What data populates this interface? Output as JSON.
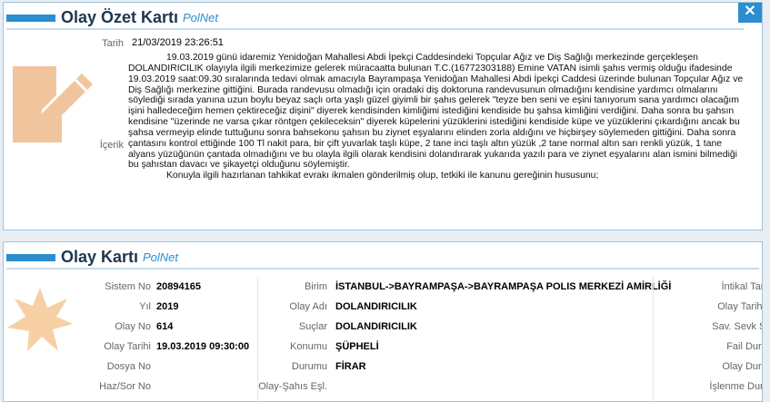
{
  "summary_card": {
    "title": "Olay Özet Kartı",
    "subtitle": "PolNet",
    "close": "✕",
    "date_label": "Tarih",
    "date_value": "21/03/2019 23:26:51",
    "content_label": "İçerik",
    "paragraph1": "19.03.2019 günü idaremiz Yenidoğan Mahallesi Abdi İpekçi Caddesindeki Topçular Ağız ve Diş Sağlığı merkezinde gerçekleşen DOLANDIRICILIK olayıyla ilgili merkezimize gelerek müracaatta bulunan T.C.(16772303188) Emine VATAN isimli şahıs vermiş olduğu ifadesinde 19.03.2019 saat:09.30 sıralarında tedavi olmak amacıyla Bayrampaşa Yenidoğan Mahallesi Abdi İpekçi Caddesi üzerinde bulunan Topçular Ağız ve Diş Sağlığı merkezine gittiğini. Burada randevusu olmadığı için oradaki diş doktoruna randevusunun olmadığını kendisine yardımcı olmalarını söylediği sırada yanına uzun boylu beyaz saçlı orta yaşlı güzel giyimli bir şahıs gelerek \"teyze ben seni ve eşini tanıyorum sana yardımcı olacağım işini halledeceğim hemen çektireceğiz dişini\" diyerek kendisinden kimliğimi istediğini kendiside bu şahsa kimliğini verdiğini. Daha sonra bu şahsın kendisine \"üzerinde ne varsa çıkar röntgen çekileceksin\" diyerek küpelerini yüzüklerini istediğini kendiside küpe ve yüzüklerini çıkardığını ancak bu şahsa vermeyip elinde tuttuğunu sonra bahsekonu şahsın bu ziynet eşyalarını elinden zorla aldığını ve hiçbirşey söylemeden gittiğini. Daha sonra çantasını kontrol ettiğinde 100 Tl nakit para, bir çift yuvarlak taşlı küpe, 2 tane inci taşlı altın yüzük ,2 tane normal altın sarı renkli yüzük, 1 tane alyans yüzüğünün çantada olmadığını ve bu olayla ilgili olarak kendisini dolandırarak yukarıda yazılı para ve ziynet eşyalarını alan ismini bilmediği bu şahıstan davacı ve şikayetçi olduğunu söylemiştir.",
    "paragraph2": "Konuyla ilgili hazırlanan tahkikat evrakı ikmalen gönderilmiş olup, tetkiki ile kanunu gereğinin hususunu;"
  },
  "event_card": {
    "title": "Olay Kartı",
    "subtitle": "PolNet",
    "col1": {
      "sistem_no_label": "Sistem No",
      "sistem_no": "20894165",
      "yil_label": "Yıl",
      "yil": "2019",
      "olay_no_label": "Olay No",
      "olay_no": "614",
      "olay_tarihi_label": "Olay Tarihi",
      "olay_tarihi": "19.03.2019 09:30:00",
      "dosya_no_label": "Dosya No",
      "dosya_no": "",
      "haz_sor_no_label": "Haz/Sor No",
      "haz_sor_no": ""
    },
    "col2": {
      "birim_label": "Birim",
      "birim": "İSTANBUL->BAYRAMPAŞA->BAYRAMPAŞA POLIS MERKEZİ AMİRLİĞİ",
      "olay_adi_label": "Olay Adı",
      "olay_adi": "DOLANDIRICILIK",
      "suclar_label": "Suçlar",
      "suclar": "DOLANDIRICILIK",
      "konumu_label": "Konumu",
      "konumu": "ŞÜPHELİ",
      "durumu_label": "Durumu",
      "durumu": "FİRAR",
      "olay_sahis_label": "Olay-Şahıs Eşl.",
      "olay_sahis": ""
    },
    "col3": {
      "intikal_label": "İntikal Tarih",
      "olay_tarihi_label": "Olay Tarihi",
      "sav_sevk_label": "Sav. Sevk Şek",
      "fail_durum_label": "Fail Durum",
      "olay_durum_label": "Olay Durum",
      "islenme_durum_label": "İşlenme Durum"
    }
  }
}
